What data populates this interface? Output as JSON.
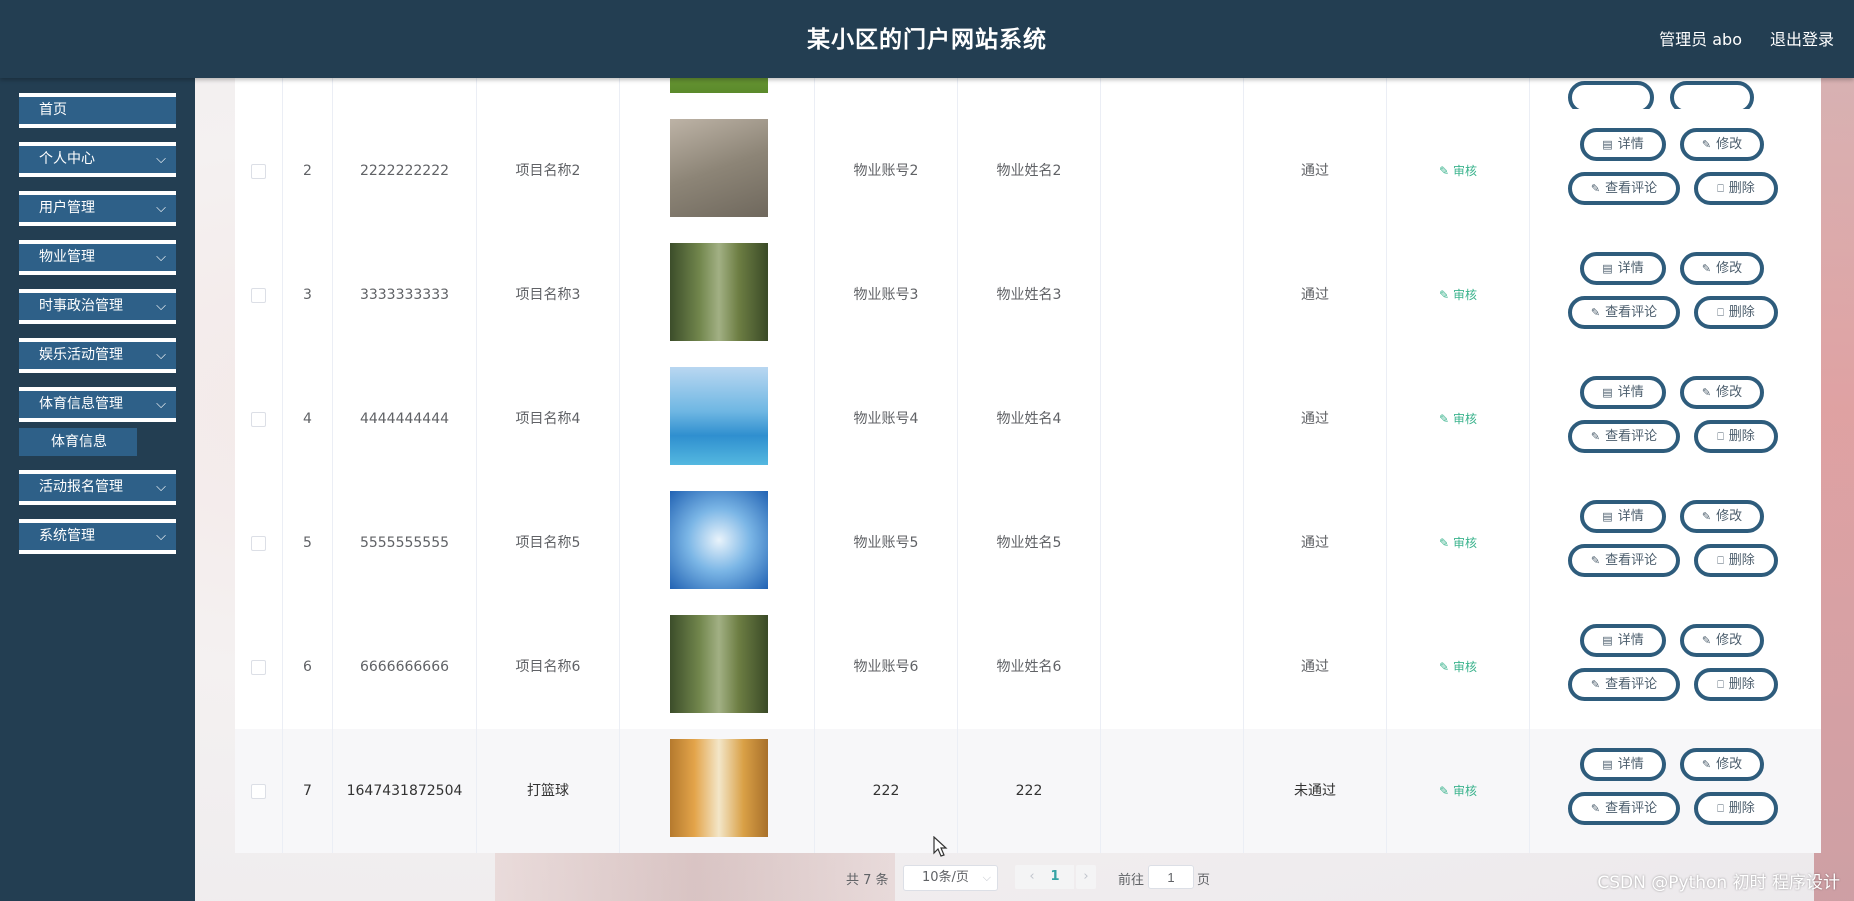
{
  "header": {
    "title": "某小区的门户网站系统",
    "user": "管理员 abo",
    "logout": "退出登录"
  },
  "sidebar": {
    "items": [
      {
        "label": "首页",
        "expandable": false
      },
      {
        "label": "个人中心",
        "expandable": true
      },
      {
        "label": "用户管理",
        "expandable": true
      },
      {
        "label": "物业管理",
        "expandable": true
      },
      {
        "label": "时事政治管理",
        "expandable": true
      },
      {
        "label": "娱乐活动管理",
        "expandable": true
      },
      {
        "label": "体育信息管理",
        "expandable": true
      },
      {
        "label": "活动报名管理",
        "expandable": true
      },
      {
        "label": "系统管理",
        "expandable": true
      }
    ],
    "submenu": {
      "label": "体育信息"
    }
  },
  "table": {
    "rows": [
      {
        "index": "2",
        "code": "2222222222",
        "project": "项目名称2",
        "account": "物业账号2",
        "name": "物业姓名2",
        "status": "通过",
        "photo": "badminton"
      },
      {
        "index": "3",
        "code": "3333333333",
        "project": "项目名称3",
        "account": "物业账号3",
        "name": "物业姓名3",
        "status": "通过",
        "photo": "forest-woman"
      },
      {
        "index": "4",
        "code": "4444444444",
        "project": "项目名称4",
        "account": "物业账号4",
        "name": "物业姓名4",
        "status": "通过",
        "photo": "runner-lake"
      },
      {
        "index": "5",
        "code": "5555555555",
        "project": "项目名称5",
        "account": "物业账号5",
        "name": "物业姓名5",
        "status": "通过",
        "photo": "skateboard-sky"
      },
      {
        "index": "6",
        "code": "6666666666",
        "project": "项目名称6",
        "account": "物业账号6",
        "name": "物业姓名6",
        "status": "通过",
        "photo": "forest-woman"
      },
      {
        "index": "7",
        "code": "1647431872504",
        "project": "打篮球",
        "account": "222",
        "name": "222",
        "status": "未通过",
        "photo": "library"
      }
    ],
    "audit_label": "审核",
    "actions": {
      "detail": "详情",
      "edit": "修改",
      "comments": "查看评论",
      "delete": "删除"
    }
  },
  "pagination": {
    "total": "共 7 条",
    "page_size": "10条/页",
    "current_page": "1",
    "goto_label": "前往",
    "goto_value": "1",
    "page_unit": "页"
  },
  "watermark": "CSDN @Python 初时 程序设计",
  "colors": {
    "header_bg": "#233e52",
    "menu_item_bg": "#2e6088",
    "button_border": "#2e5c7c",
    "audit_green": "#3bb38d",
    "page_active": "#37a3a4"
  }
}
